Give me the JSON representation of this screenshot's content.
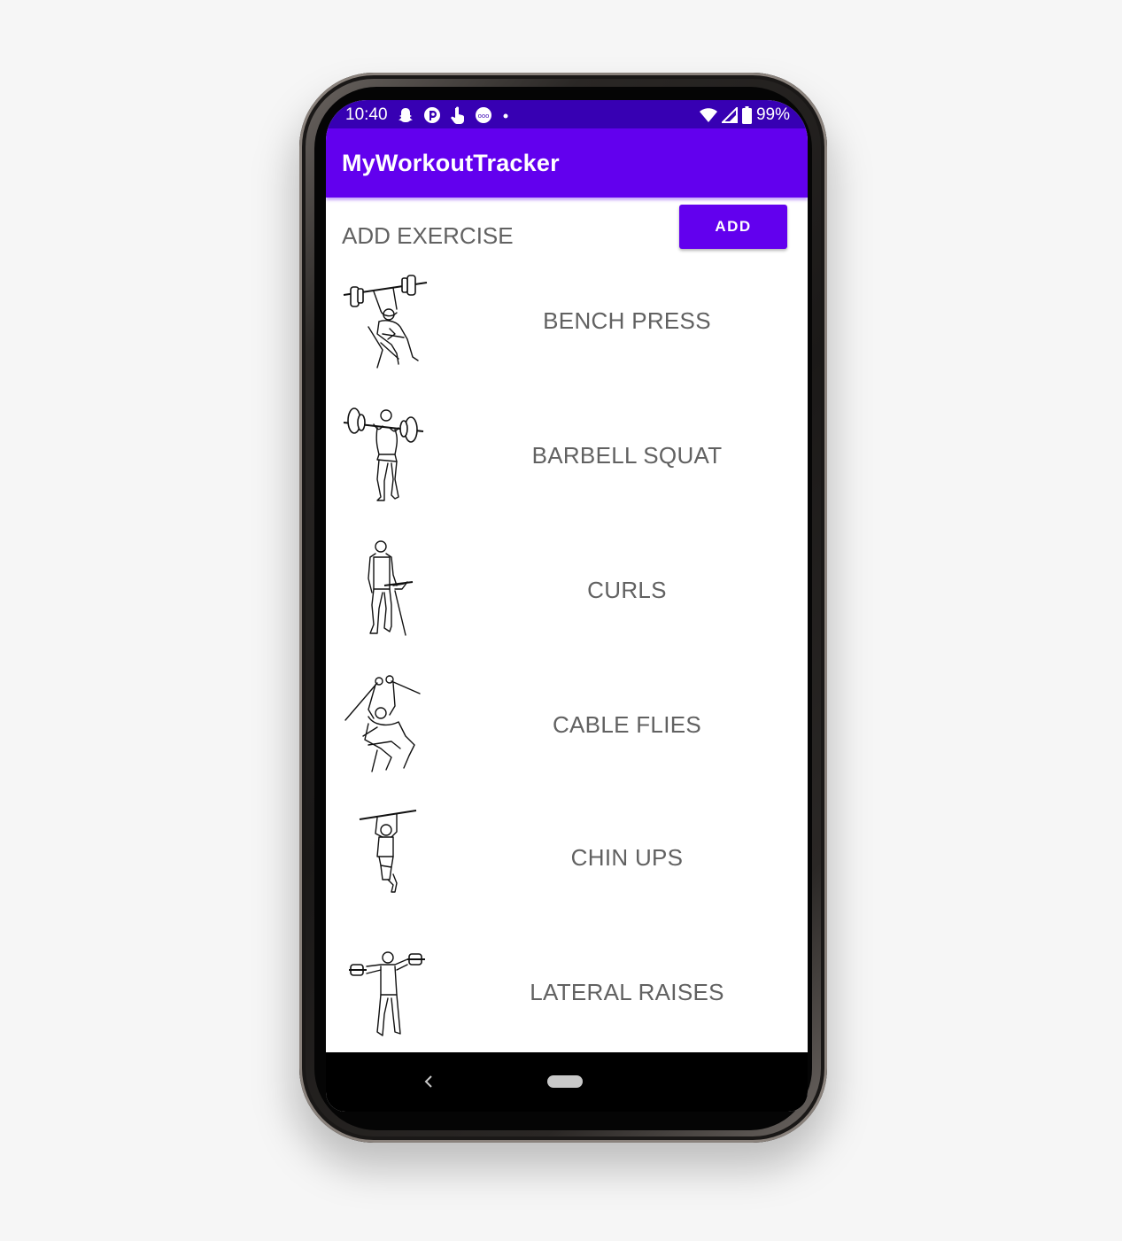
{
  "status_bar": {
    "time": "10:40",
    "battery": "99%",
    "icons_left": [
      "snapchat-icon",
      "pocket-casts-icon",
      "hand-touch-icon",
      "weather-app-icon",
      "notification-dot-icon"
    ],
    "icons_right": [
      "wifi-icon",
      "cell-signal-icon",
      "battery-icon"
    ]
  },
  "app_bar": {
    "title": "MyWorkoutTracker"
  },
  "add_section": {
    "label": "ADD EXERCISE",
    "button_label": "ADD"
  },
  "exercises": [
    {
      "name": "BENCH PRESS",
      "icon": "bench-press-figure-icon"
    },
    {
      "name": "BARBELL SQUAT",
      "icon": "barbell-squat-figure-icon"
    },
    {
      "name": "CURLS",
      "icon": "curls-figure-icon"
    },
    {
      "name": "CABLE FLIES",
      "icon": "cable-flies-figure-icon"
    },
    {
      "name": "CHIN UPS",
      "icon": "chin-ups-figure-icon"
    },
    {
      "name": "LATERAL RAISES",
      "icon": "lateral-raises-figure-icon"
    }
  ],
  "colors": {
    "primary": "#6200ee",
    "primary_dark": "#3700b3",
    "text_secondary": "#616161",
    "background": "#ffffff"
  },
  "nav_bar": {
    "icons": [
      "back-icon",
      "home-pill-icon"
    ]
  }
}
